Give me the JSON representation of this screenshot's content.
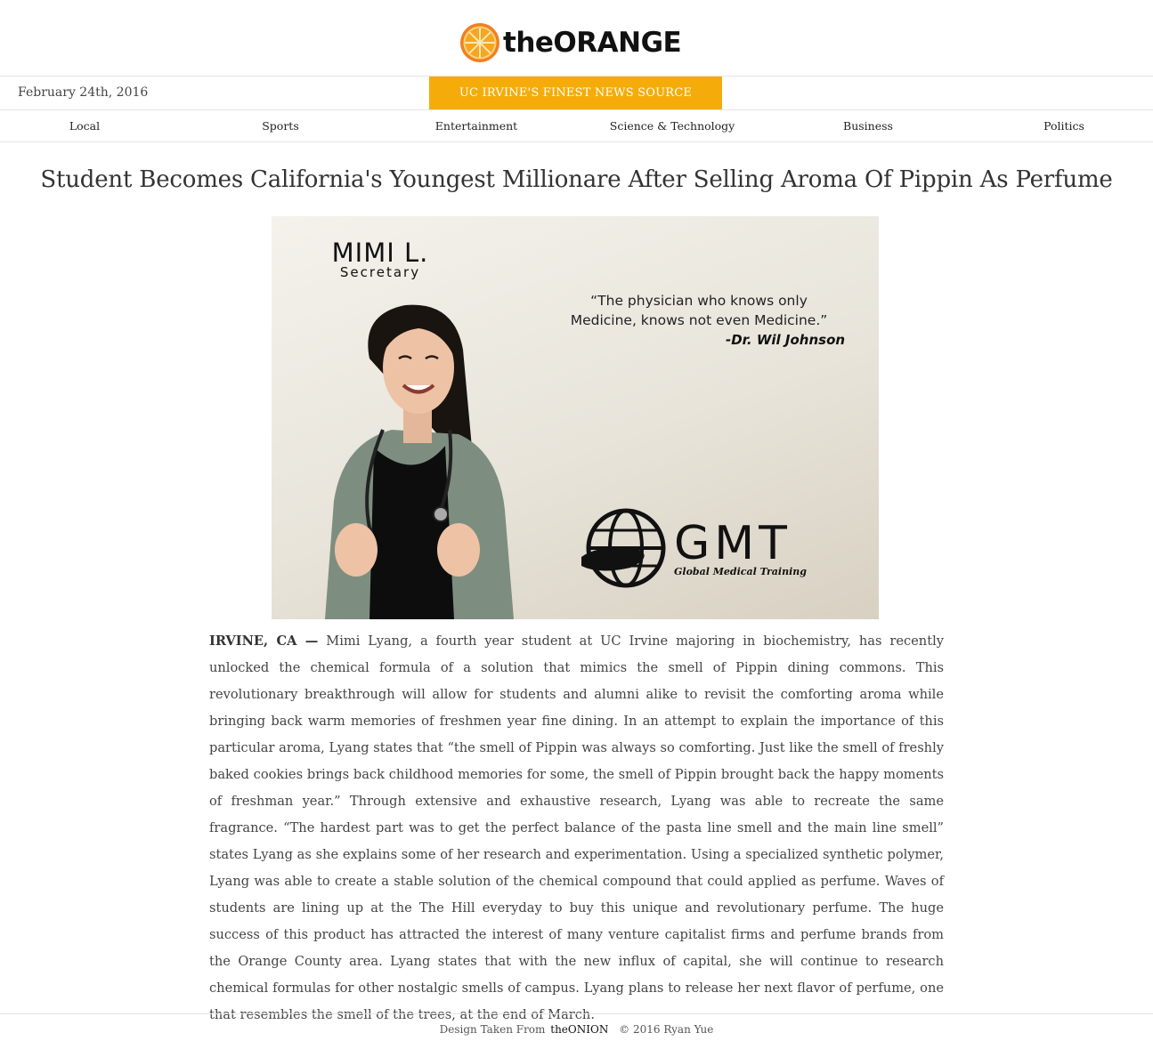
{
  "header": {
    "logo_text": "theORANGE",
    "date": "February 24th, 2016",
    "tagline": "UC IRVINE'S FINEST NEWS SOURCE"
  },
  "nav": {
    "items": [
      {
        "label": "Local"
      },
      {
        "label": "Sports"
      },
      {
        "label": "Entertainment"
      },
      {
        "label": "Science & Technology"
      },
      {
        "label": "Business"
      },
      {
        "label": "Politics"
      }
    ]
  },
  "article": {
    "headline": "Student Becomes California's Youngest Millionare After Selling Aroma Of Pippin As Perfume",
    "image": {
      "name": "MIMI L.",
      "title": "Secretary",
      "quote_line1": "“The physician who knows only",
      "quote_line2": "Medicine, knows not even Medicine.”",
      "quote_author": "-Dr. Wil Johnson",
      "org_logo_text": "GMT",
      "org_logo_sub": "Global Medical Training"
    },
    "dateline": "IRVINE, CA —",
    "body": "Mimi Lyang, a fourth year student at UC Irvine majoring in biochemistry, has recently unlocked the chemical formula of a solution that mimics the smell of Pippin dining commons. This revolutionary breakthrough will allow for students and alumni alike to revisit the comforting aroma while bringing back warm memories of freshmen year fine dining. In an attempt to explain the importance of this particular aroma, Lyang states that “the smell of Pippin was always so comforting. Just like the smell of freshly baked cookies brings back childhood memories for some, the smell of Pippin brought back the happy moments of freshman year.” Through extensive and exhaustive research, Lyang was able to recreate the same fragrance. “The hardest part was to get the perfect balance of the pasta line smell and the main line smell” states Lyang as she explains some of her research and experimentation. Using a specialized synthetic polymer, Lyang was able to create a stable solution of the chemical compound that could applied as perfume. Waves of students are lining up at the The Hill everyday to buy this unique and revolutionary perfume. The huge success of this product has attracted the interest of many venture capitalist firms and perfume brands from the Orange County area. Lyang states that with the new influx of capital, she will continue to research chemical formulas for other nostalgic smells of campus. Lyang plans to release her next flavor of perfume, one that resembles the smell of the trees, at the end of March."
  },
  "footer": {
    "prefix": "Design Taken From",
    "brand": "theONION",
    "copyright": "© 2016 Ryan Yue"
  },
  "colors": {
    "accent": "#f5ac0a",
    "logo_orange": "#f29a1f"
  }
}
